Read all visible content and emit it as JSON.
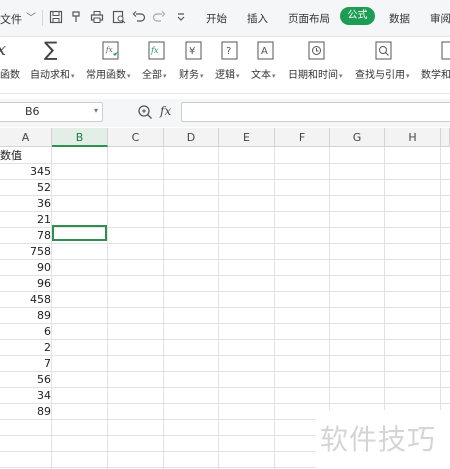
{
  "menubar": {
    "file_label": "文件",
    "tabs": [
      "开始",
      "插入",
      "页面布局",
      "公式",
      "数据",
      "审阅"
    ],
    "active_tab": "公式",
    "quick_access": [
      "save-icon",
      "format-painter-icon",
      "print-icon",
      "print-preview-icon",
      "undo-icon",
      "redo-icon",
      "more-icon"
    ]
  },
  "ribbon": {
    "items": [
      {
        "label": "函数",
        "icon": "fx-icon"
      },
      {
        "label": "自动求和",
        "icon": "sum-icon"
      },
      {
        "label": "常用函数",
        "icon": "common-function-icon"
      },
      {
        "label": "全部",
        "icon": "all-functions-icon"
      },
      {
        "label": "财务",
        "icon": "finance-icon"
      },
      {
        "label": "逻辑",
        "icon": "logic-icon"
      },
      {
        "label": "文本",
        "icon": "text-icon"
      },
      {
        "label": "日期和时间",
        "icon": "datetime-icon"
      },
      {
        "label": "查找与引用",
        "icon": "lookup-icon"
      },
      {
        "label": "数学和",
        "icon": "math-icon"
      }
    ]
  },
  "formula_bar": {
    "name_box": "B6",
    "fx": "fx",
    "formula": ""
  },
  "sheet": {
    "columns": [
      "A",
      "B",
      "C",
      "D",
      "E",
      "F",
      "G",
      "H"
    ],
    "selected_column": "B",
    "selected_cell": "B6",
    "header_cell": "数值",
    "values": [
      "345",
      "52",
      "36",
      "21",
      "78",
      "758",
      "90",
      "96",
      "458",
      "89",
      "6",
      "2",
      "7",
      "56",
      "34",
      "89"
    ]
  },
  "watermark": "软件技巧",
  "colors": {
    "accent": "#1e9c54",
    "selection": "#2f8f4f"
  }
}
